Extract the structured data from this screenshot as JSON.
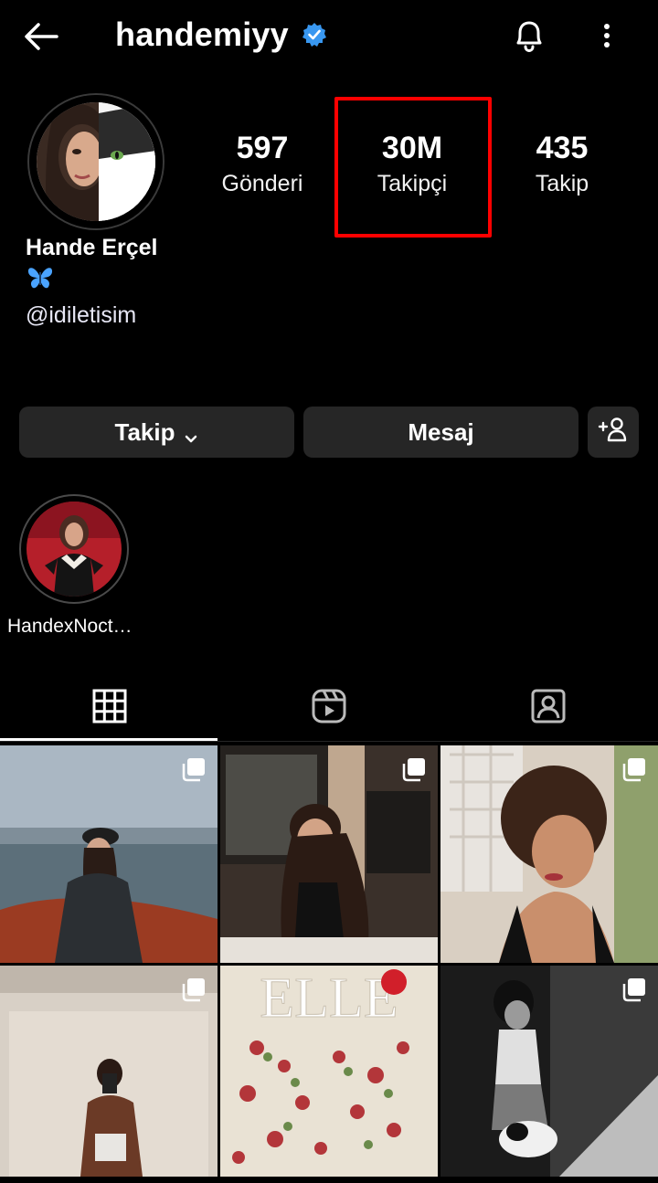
{
  "header": {
    "username": "handemiyy",
    "icons": [
      "back-arrow-icon",
      "verified-badge-icon",
      "bell-icon",
      "more-vertical-icon"
    ]
  },
  "profile": {
    "display_name": "Hande Erçel",
    "bio_emoji": "🦋",
    "handle": "@idiletisim"
  },
  "stats": [
    {
      "value": "597",
      "label": "Gönderi"
    },
    {
      "value": "30M",
      "label": "Takipçi"
    },
    {
      "value": "435",
      "label": "Takip"
    }
  ],
  "buttons": {
    "follow": "Takip",
    "message": "Mesaj"
  },
  "highlights": [
    {
      "label": "HandexNoct…"
    }
  ],
  "tabs": [
    "grid-icon",
    "reels-icon",
    "tagged-icon"
  ],
  "colors": {
    "background": "#000000",
    "button": "#262626",
    "verified": "#3897f0",
    "annotation": "#ff0000"
  }
}
